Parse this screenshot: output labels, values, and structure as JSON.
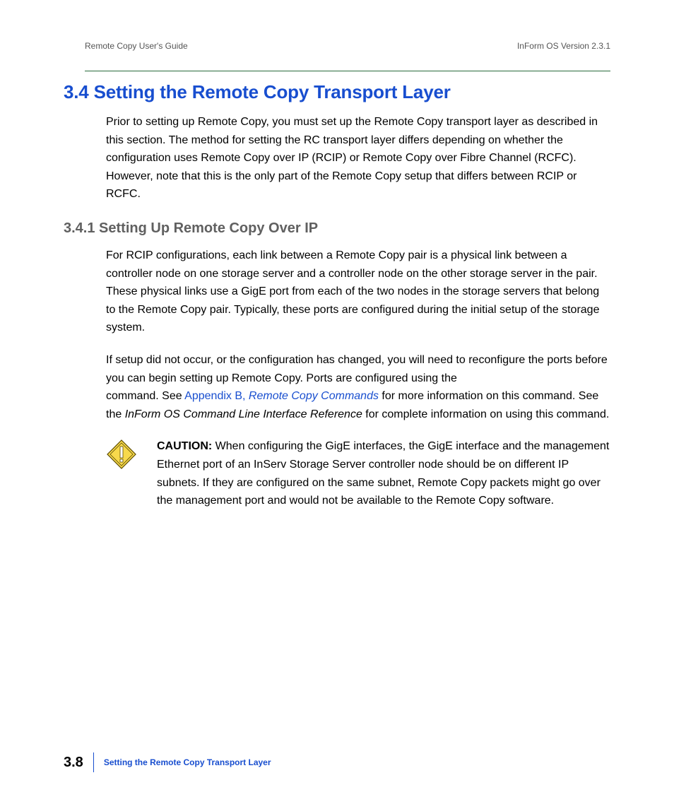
{
  "header": {
    "left": "Remote Copy User's Guide",
    "right": "InForm OS Version 2.3.1"
  },
  "section": {
    "number_title": "3.4  Setting the Remote Copy Transport Layer",
    "intro": "Prior to setting up Remote Copy, you must set up the Remote Copy transport layer as described in this section. The method for setting the RC transport layer differs depending on whether the configuration uses Remote Copy over IP (RCIP) or Remote Copy over Fibre Channel (RCFC). However, note that this is the only part of the Remote Copy setup that differs between RCIP or RCFC."
  },
  "subsection": {
    "title": "3.4.1 Setting Up Remote Copy Over IP",
    "p1": "For RCIP configurations, each link between a Remote Copy pair is a physical link between a controller node on one storage server and a controller node on the other storage server in the pair. These physical links use a GigE port from each of the two nodes in the storage servers that belong to the Remote Copy pair. Typically, these ports are configured during the initial setup of the storage system.",
    "p2_a": "If setup did not occur, or the configuration has changed, you will need to reconfigure the ports before you can begin setting up Remote Copy. Ports are configured using the ",
    "p2_cmd_gap": "                                     ",
    "p2_b": " command. See ",
    "p2_link1": "Appendix B, ",
    "p2_link2": "Remote Copy Commands",
    "p2_c": " for more information on this command. See the ",
    "p2_ref": "InForm OS Command Line Interface Reference",
    "p2_d": " for complete information on using this command."
  },
  "caution": {
    "label": "CAUTION:",
    "text": " When configuring the GigE interfaces, the GigE interface and the management Ethernet port of an InServ Storage Server controller node should be on different IP subnets. If they are configured on the same subnet, Remote Copy packets might go over the management port and would not be available to the Remote Copy software."
  },
  "footer": {
    "page": "3.8",
    "title": "Setting the Remote Copy Transport Layer"
  }
}
